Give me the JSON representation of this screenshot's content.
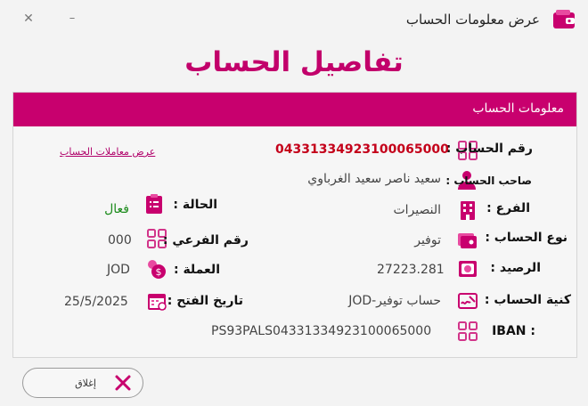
{
  "window": {
    "title": "عرض معلومات الحساب",
    "minimize_glyph": "–",
    "close_glyph": "✕"
  },
  "heading": "تفاصيل الحساب",
  "section": {
    "title": "معلومات الحساب"
  },
  "account": {
    "number_label": "رقم الحساب :",
    "number_value": "04331334923100065000",
    "transactions_link": "عرض معاملات الحساب",
    "holder_label": "صاحب الحساب :",
    "holder_value": "سعيد ناصر سعيد الغرباوي",
    "branch_label": "الفرع :",
    "branch_value": "النصيرات",
    "status_label": "الحالة :",
    "status_value": "فعال",
    "type_label": "نوع الحساب :",
    "type_value": "توفير",
    "sub_number_label": "رقم الفرعي :",
    "sub_number_value": "000",
    "balance_label": "الرصيد :",
    "balance_value": "27223.281",
    "currency_label": "العملة :",
    "currency_value": "JOD",
    "nickname_label": "كنية الحساب :",
    "nickname_value": "حساب توفير-JOD",
    "open_date_label": "تاريخ الفتح :",
    "open_date_value": "25/5/2025",
    "iban_label": "IBAN :",
    "iban_value": "PS93PALS04331334923100065000"
  },
  "footer": {
    "close_label": "إغلاق"
  },
  "colors": {
    "accent": "#c8006e",
    "heading": "#c2006b",
    "account_number": "#c4001a",
    "active": "#1a8a1a"
  },
  "icons": [
    "wallet-icon",
    "grid-number-icon",
    "user-icon",
    "building-icon",
    "clipboard-icon",
    "card-stack-icon",
    "coins-icon",
    "money-bag-icon",
    "calendar-icon",
    "signature-icon",
    "close-icon"
  ]
}
